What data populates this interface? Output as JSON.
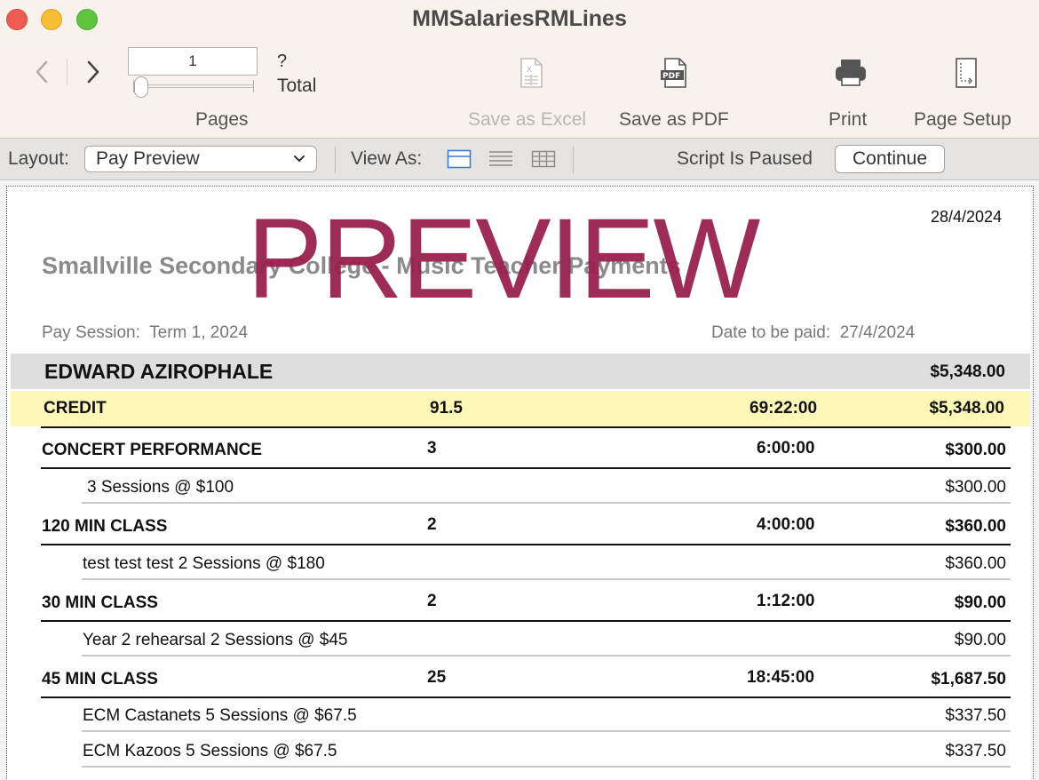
{
  "window": {
    "title": "MMSalariesRMLines"
  },
  "toolbar": {
    "page_value": "1",
    "total_value": "?",
    "total_label": "Total",
    "pages_label": "Pages",
    "save_excel_label": "Save as Excel",
    "save_pdf_label": "Save as PDF",
    "print_label": "Print",
    "page_setup_label": "Page Setup"
  },
  "layout_bar": {
    "layout_label": "Layout:",
    "layout_value": "Pay Preview",
    "view_as_label": "View As:",
    "script_status": "Script Is Paused",
    "continue_label": "Continue"
  },
  "report": {
    "date": "28/4/2024",
    "title": "Smallville Secondary College - Music Teacher Payments",
    "watermark": "PREVIEW",
    "pay_session_label": "Pay Session:",
    "pay_session_value": "Term 1, 2024",
    "date_paid_label": "Date to be paid:",
    "date_paid_value": "27/4/2024",
    "employee": {
      "name": "EDWARD AZIROPHALE",
      "total": "$5,348.00"
    },
    "credit": {
      "label": "CREDIT",
      "count": "91.5",
      "time": "69:22:00",
      "amount": "$5,348.00"
    },
    "categories": [
      {
        "name": "CONCERT PERFORMANCE",
        "count": "3",
        "time": "6:00:00",
        "amount": "$300.00",
        "lines": [
          {
            "desc": "3 Sessions @ $100",
            "amount": "$300.00"
          }
        ]
      },
      {
        "name": "120 MIN CLASS",
        "count": "2",
        "time": "4:00:00",
        "amount": "$360.00",
        "lines": [
          {
            "desc": "test test test 2 Sessions @ $180",
            "amount": "$360.00"
          }
        ]
      },
      {
        "name": "30 MIN CLASS",
        "count": "2",
        "time": "1:12:00",
        "amount": "$90.00",
        "lines": [
          {
            "desc": "Year 2 rehearsal 2 Sessions @ $45",
            "amount": "$90.00"
          }
        ]
      },
      {
        "name": "45 MIN CLASS",
        "count": "25",
        "time": "18:45:00",
        "amount": "$1,687.50",
        "lines": [
          {
            "desc": "ECM Castanets 5 Sessions @ $67.5",
            "amount": "$337.50"
          },
          {
            "desc": "ECM Kazoos 5 Sessions @ $67.5",
            "amount": "$337.50"
          }
        ]
      }
    ]
  }
}
